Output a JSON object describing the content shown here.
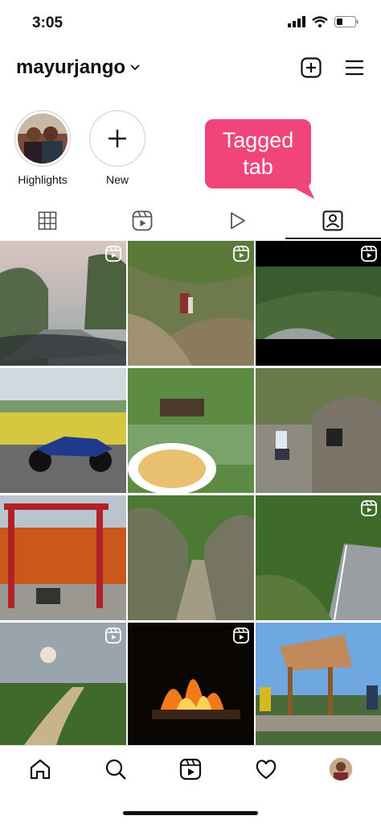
{
  "status": {
    "time": "3:05"
  },
  "profile": {
    "username": "mayurjango"
  },
  "highlights": [
    {
      "label": "Highlights"
    },
    {
      "label": "New"
    }
  ],
  "callout": {
    "line1": "Tagged",
    "line2": "tab"
  },
  "tabs": [
    {
      "name": "grid-icon"
    },
    {
      "name": "reels-icon"
    },
    {
      "name": "videos-icon"
    },
    {
      "name": "tagged-icon",
      "selected": true
    }
  ],
  "colors": {
    "accent": "#f0457b",
    "text": "#111111"
  },
  "nav": [
    {
      "name": "home-icon"
    },
    {
      "name": "search-icon"
    },
    {
      "name": "reels-icon"
    },
    {
      "name": "heart-icon"
    },
    {
      "name": "profile-avatar"
    }
  ]
}
